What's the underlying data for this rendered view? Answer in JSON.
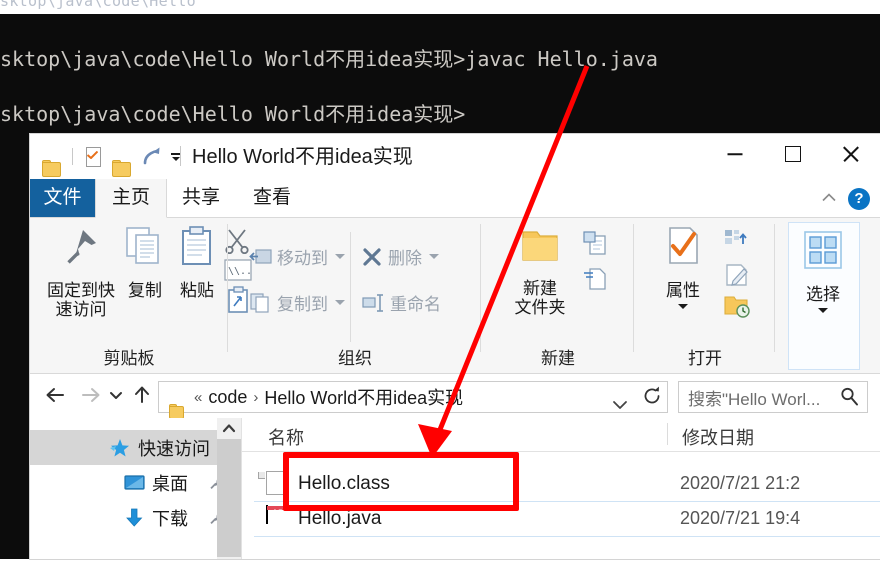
{
  "console": {
    "cut_line": "sktop\\java\\code\\Hello",
    "line1": "sktop\\java\\code\\Hello World不用idea实现>javac Hello.java",
    "line2": "sktop\\java\\code\\Hello World不用idea实现>"
  },
  "window": {
    "title": "Hello World不用idea实现",
    "quick_access": [
      {
        "name": "folder-icon",
        "label": "文件夹"
      },
      {
        "name": "properties-icon",
        "label": "属性"
      },
      {
        "name": "new-folder-icon",
        "label": "新建文件夹"
      },
      {
        "name": "redo-icon",
        "label": "恢复"
      },
      {
        "name": "customize-qat-icon",
        "label": "自定义快速访问工具栏"
      }
    ],
    "controls": {
      "minimize": "最小化",
      "maximize": "最大化",
      "close": "关闭"
    },
    "help_label": "?"
  },
  "ribbon": {
    "tabs": [
      {
        "label": "文件",
        "state": "file"
      },
      {
        "label": "主页",
        "state": "active"
      },
      {
        "label": "共享",
        "state": "normal"
      },
      {
        "label": "查看",
        "state": "normal"
      }
    ],
    "groups": [
      {
        "name": "clipboard",
        "label": "剪贴板",
        "big_buttons": [
          {
            "label": "固定到快\n速访问",
            "line1": "固定到快",
            "line2": "速访问",
            "icon": "pin-icon"
          },
          {
            "label": "复制",
            "line1": "复制",
            "line2": "",
            "icon": "copy-icon"
          },
          {
            "label": "粘贴",
            "line1": "粘贴",
            "line2": "",
            "icon": "paste-icon"
          }
        ],
        "small_buttons": [
          {
            "label": "",
            "icon": "cut-icon"
          },
          {
            "label": "",
            "icon": "copy-path-icon"
          },
          {
            "label": "",
            "icon": "paste-shortcut-icon"
          }
        ]
      },
      {
        "name": "organize",
        "label": "组织",
        "small_buttons": [
          {
            "label": "移动到",
            "icon": "move-to-icon",
            "has_caret": true
          },
          {
            "label": "复制到",
            "icon": "copy-to-icon",
            "has_caret": true
          },
          {
            "label": "删除",
            "icon": "delete-icon",
            "has_caret": true
          },
          {
            "label": "重命名",
            "icon": "rename-icon",
            "has_caret": false
          }
        ]
      },
      {
        "name": "new",
        "label": "新建",
        "big_buttons": [
          {
            "line1": "新建",
            "line2": "文件夹",
            "icon": "new-folder-icon"
          }
        ],
        "small_buttons": [
          {
            "label": "",
            "icon": "new-item-icon",
            "has_caret": true
          },
          {
            "label": "",
            "icon": "easy-access-icon",
            "has_caret": true
          }
        ]
      },
      {
        "name": "open",
        "label": "打开",
        "big_buttons": [
          {
            "line1": "属性",
            "line2": "",
            "icon": "properties-icon",
            "has_caret": true
          }
        ],
        "small_buttons": [
          {
            "label": "",
            "icon": "open-with-icon",
            "has_caret": true
          },
          {
            "label": "",
            "icon": "edit-icon",
            "has_caret": false
          },
          {
            "label": "",
            "icon": "history-icon",
            "has_caret": false
          }
        ]
      },
      {
        "name": "select",
        "label": "",
        "big_buttons": [
          {
            "line1": "选择",
            "line2": "",
            "icon": "select-icon",
            "has_caret": true
          }
        ]
      }
    ]
  },
  "address": {
    "back_label": "后退",
    "forward_label": "前进",
    "recent_label": "最近浏览的位置",
    "up_label": "上移一级",
    "crumbs": [
      "code",
      "Hello World不用idea实现"
    ],
    "prefix": "«",
    "dropdown_label": "以前的位置",
    "refresh_label": "刷新",
    "search_placeholder": "搜索\"Hello Worl..."
  },
  "nav_pane": {
    "items": [
      {
        "label": "快速访问",
        "icon": "quick-access-star-icon",
        "selected": true,
        "pinned": false
      },
      {
        "label": "桌面",
        "icon": "desktop-icon",
        "selected": false,
        "pinned": true
      },
      {
        "label": "下载",
        "icon": "downloads-icon",
        "selected": false,
        "pinned": true
      }
    ]
  },
  "file_list": {
    "columns": [
      {
        "label": "名称"
      },
      {
        "label": "修改日期"
      }
    ],
    "rows": [
      {
        "name": "Hello.class",
        "date": "2020/7/21 21:2",
        "icon": "blank-document-icon",
        "highlighted": true
      },
      {
        "name": "Hello.java",
        "date": "2020/7/21 19:4",
        "icon": "intellij-idea-icon",
        "highlighted": false
      }
    ]
  },
  "annotations": {
    "arrow_color": "#ff0000",
    "rect_color": "#ff0000",
    "arrow_label": "指向 Hello.class 的红色箭头",
    "rect_label": "Hello.class 红色高亮框"
  }
}
